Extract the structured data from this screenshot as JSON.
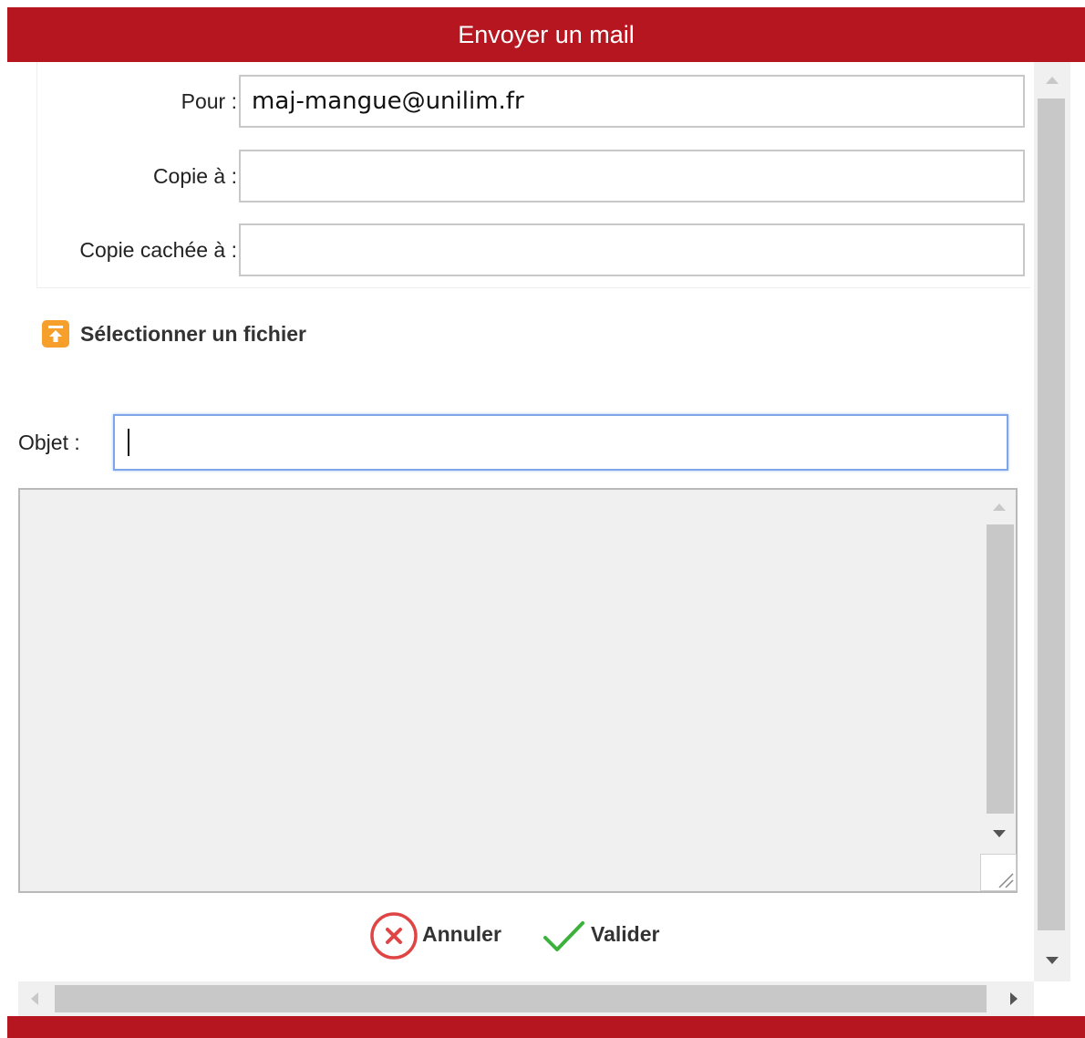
{
  "dialog": {
    "title": "Envoyer un mail"
  },
  "recipients": {
    "to_label": "Pour :",
    "to_value": "maj-mangue@unilim.fr",
    "cc_label": "Copie à :",
    "cc_value": "",
    "bcc_label": "Copie cachée à :",
    "bcc_value": ""
  },
  "attachment": {
    "label": "Sélectionner un fichier",
    "icon": "upload-file-icon"
  },
  "subject": {
    "label": "Objet :",
    "value": ""
  },
  "message": {
    "value": ""
  },
  "actions": {
    "cancel_label": "Annuler",
    "cancel_icon": "cancel-circle-icon",
    "validate_label": "Valider",
    "validate_icon": "checkmark-icon"
  },
  "colors": {
    "title_bar": "#b51620",
    "attach_icon": "#f6a02b",
    "cancel_icon": "#e04545",
    "validate_icon": "#3cb23c",
    "focus_border": "#7ea6e8"
  }
}
